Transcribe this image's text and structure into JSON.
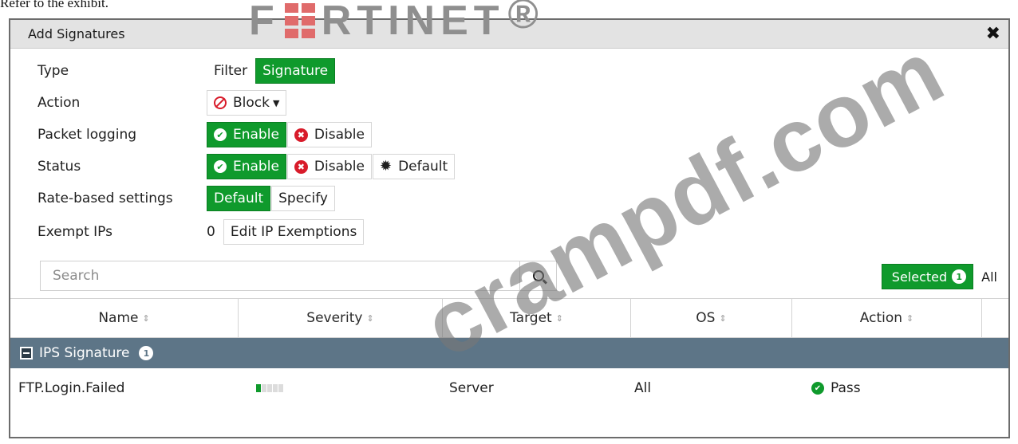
{
  "caption": "Refer to the exhibit.",
  "logo_text": "F#RTINET",
  "logo_letters": "RTINET",
  "logo_first": "F",
  "logo_reg": "®",
  "watermark": "crampdf.com",
  "colors": {
    "accent": "#0f9a2c",
    "group_header": "#5d7587",
    "danger": "#d81b2a"
  },
  "dialog": {
    "title": "Add Signatures",
    "close_icon": "close-icon"
  },
  "form": {
    "type": {
      "label": "Type",
      "options": [
        "Filter",
        "Signature"
      ],
      "selected": "Signature"
    },
    "action": {
      "label": "Action",
      "value": "Block"
    },
    "packet_logging": {
      "label": "Packet logging",
      "enable": "Enable",
      "disable": "Disable",
      "selected": "Enable"
    },
    "status": {
      "label": "Status",
      "enable": "Enable",
      "disable": "Disable",
      "default": "Default",
      "selected": "Enable"
    },
    "rate_based": {
      "label": "Rate-based settings",
      "default": "Default",
      "specify": "Specify",
      "selected": "Default"
    },
    "exempt_ips": {
      "label": "Exempt IPs",
      "count": "0",
      "button": "Edit IP Exemptions"
    }
  },
  "search": {
    "placeholder": "Search"
  },
  "filter": {
    "selected_label": "Selected",
    "selected_count": "1",
    "all_label": "All"
  },
  "table": {
    "columns": [
      "Name",
      "Severity",
      "Target",
      "OS",
      "Action"
    ],
    "group": {
      "label": "IPS Signature",
      "count": "1"
    },
    "rows": [
      {
        "name": "FTP.Login.Failed",
        "severity_level": 1,
        "severity_max": 5,
        "target": "Server",
        "os": "All",
        "action": "Pass"
      }
    ]
  }
}
